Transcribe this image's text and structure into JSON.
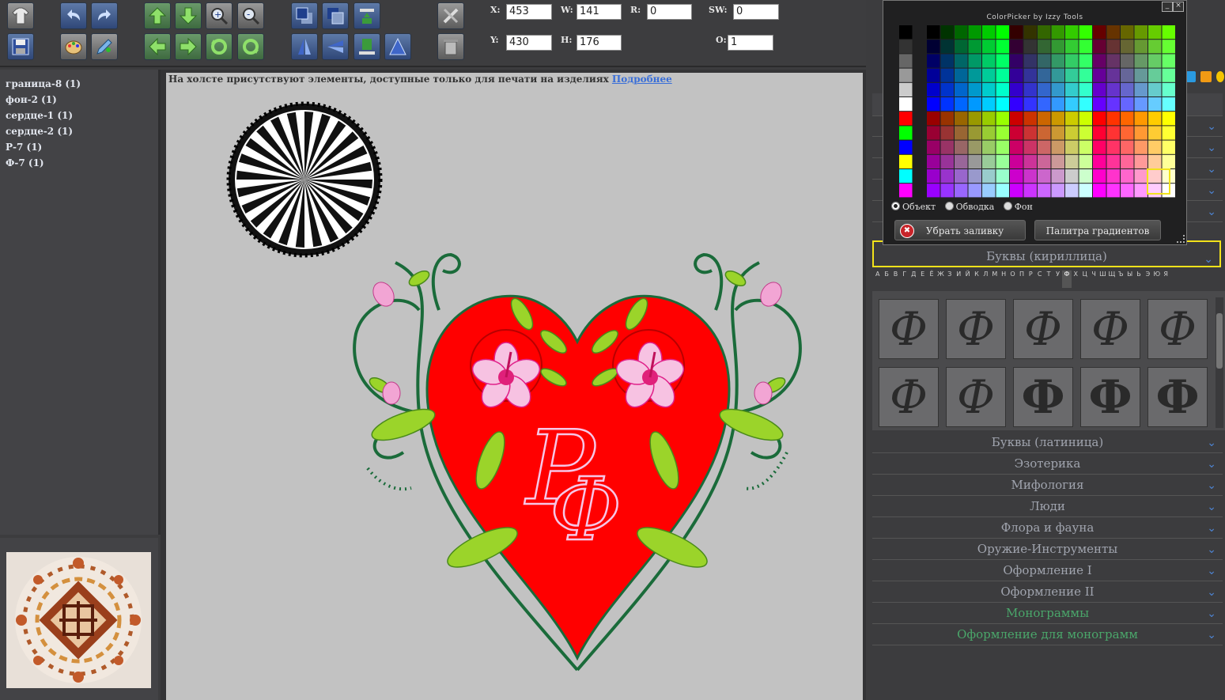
{
  "toolbar": {
    "fields": {
      "x_label": "X:",
      "x_value": "453",
      "w_label": "W:",
      "w_value": "141",
      "r_label": "R:",
      "r_value": "0",
      "sw_label": "SW:",
      "sw_value": "0",
      "y_label": "Y:",
      "y_value": "430",
      "h_label": "H:",
      "h_value": "176",
      "o_label": "O:",
      "o_value": "1"
    }
  },
  "layers": [
    "граница-8 (1)",
    "фон-2 (1)",
    "сердце-1 (1)",
    "сердце-2 (1)",
    "Р-7 (1)",
    "Ф-7 (1)"
  ],
  "canvas": {
    "notice_text": "На холсте присутствуют элементы, доступные только для печати на изделиях ",
    "notice_link": "Подробнее",
    "monogram_text": "РФ"
  },
  "color_picker": {
    "title": "ColorPicker by Izzy Tools",
    "minimize": "_",
    "close": "×",
    "radio_object": "Объект",
    "radio_stroke": "Обводка",
    "radio_background": "Фон",
    "remove_fill_button": "Убрать заливку",
    "gradient_palette_button": "Палитра градиентов"
  },
  "accordion": {
    "cyrillic": "Буквы (кириллица)",
    "latin": "Буквы (латиница)",
    "esoteric": "Эзотерика",
    "mythology": "Мифология",
    "people": "Люди",
    "flora": "Флора и фауна",
    "weapons": "Оружие-Инструменты",
    "design1": "Оформление I",
    "design2": "Оформление II",
    "monograms": "Монограммы",
    "monogram_design": "Оформление для монограмм"
  },
  "alphabet": [
    "А",
    "Б",
    "В",
    "Г",
    "Д",
    "Е",
    "Ё",
    "Ж",
    "З",
    "И",
    "Й",
    "К",
    "Л",
    "М",
    "Н",
    "О",
    "П",
    "Р",
    "С",
    "Т",
    "У",
    "Ф",
    "Х",
    "Ц",
    "Ч",
    "Ш",
    "Щ",
    "Ъ",
    "Ы",
    "Ь",
    "Э",
    "Ю",
    "Я"
  ],
  "letter_thumbs": [
    "Ф",
    "Ф",
    "Ф",
    "Ф",
    "Ф",
    "Ф",
    "Ф",
    "Ф",
    "Ф",
    "Ф"
  ],
  "colors": {
    "accent_blue": "#4e84d2",
    "highlight_yellow": "#f2e21a",
    "heart_red": "#ff0000",
    "stem_green": "#1a6b3a"
  }
}
